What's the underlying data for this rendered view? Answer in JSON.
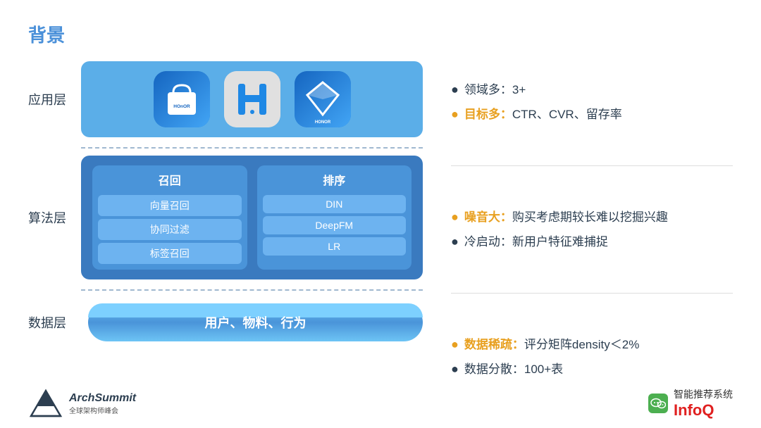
{
  "title": "背景",
  "layers": {
    "application": {
      "label": "应用层",
      "icons": [
        {
          "id": "honor-shop",
          "type": "bag",
          "text": "HOnOR"
        },
        {
          "id": "honor-h",
          "type": "H"
        },
        {
          "id": "honor-diamond",
          "type": "diamond",
          "text": "HONOR"
        }
      ]
    },
    "algorithm": {
      "label": "算法层",
      "recall": {
        "title": "召回",
        "items": [
          "向量召回",
          "协同过滤",
          "标签召回"
        ]
      },
      "rank": {
        "title": "排序",
        "items": [
          "DIN",
          "DeepFM",
          "LR"
        ]
      }
    },
    "data": {
      "label": "数据层",
      "content": "用户、物料、行为"
    }
  },
  "bullets": {
    "group1": [
      {
        "text": "领域多：3+",
        "highlight": null,
        "highlightType": null
      },
      {
        "text": "目标多：CTR、CVR、留存率",
        "highlight": "目标多：",
        "highlightType": "yellow"
      }
    ],
    "group2": [
      {
        "text": "噪音大：购买考虑期较长难以挖掘兴趣",
        "highlight": "噪音大：",
        "highlightType": "yellow"
      },
      {
        "text": "冷启动：新用户特征难捕捉",
        "highlight": null
      }
    ],
    "group3": [
      {
        "text": "数据稀疏：评分矩阵density＜2%",
        "highlight": "数据稀疏：",
        "highlightType": "yellow"
      },
      {
        "text": "数据分散：100+表",
        "highlight": null
      }
    ]
  },
  "footer": {
    "archsummit": "ArchSummit",
    "archsummit_sub": "全球架构师峰会",
    "wechat_label": "智能推荐系统",
    "infoq": "InfoQ"
  }
}
